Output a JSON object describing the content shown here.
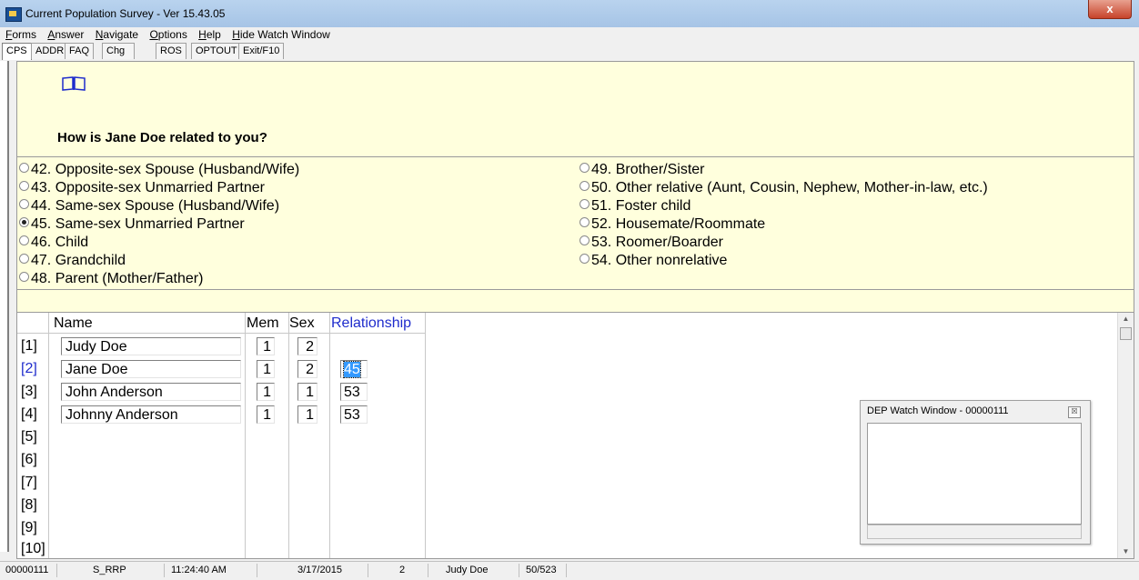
{
  "window": {
    "title": "Current Population Survey - Ver 15.43.05",
    "close_label": "x"
  },
  "menu": [
    "Forms",
    "Answer",
    "Navigate",
    "Options",
    "Help",
    "Hide Watch Window"
  ],
  "tabs": [
    "CPS",
    "ADDR",
    "FAQ",
    "Chg Resp",
    "ROS",
    "OPTOUT",
    "Exit/F10"
  ],
  "question": {
    "icon": "book-icon",
    "text": "How is Jane Doe related to you?"
  },
  "options": [
    {
      "label": "42. Opposite-sex Spouse (Husband/Wife)",
      "selected": false
    },
    {
      "label": "43. Opposite-sex Unmarried Partner",
      "selected": false
    },
    {
      "label": "44. Same-sex Spouse (Husband/Wife)",
      "selected": false
    },
    {
      "label": "45. Same-sex Unmarried Partner",
      "selected": true
    },
    {
      "label": "46. Child",
      "selected": false
    },
    {
      "label": "47. Grandchild",
      "selected": false
    },
    {
      "label": "48. Parent (Mother/Father)",
      "selected": false
    },
    {
      "label": "49. Brother/Sister",
      "selected": false
    },
    {
      "label": "50. Other relative (Aunt, Cousin, Nephew, Mother-in-law, etc.)",
      "selected": false
    },
    {
      "label": "51. Foster child",
      "selected": false
    },
    {
      "label": "52. Housemate/Roommate",
      "selected": false
    },
    {
      "label": "53. Roomer/Boarder",
      "selected": false
    },
    {
      "label": "54. Other nonrelative",
      "selected": false
    }
  ],
  "roster": {
    "headers": {
      "name": "Name",
      "mem": "Mem",
      "sex": "Sex",
      "relationship": "Relationship"
    },
    "row_labels": [
      "[1]",
      "[2]",
      "[3]",
      "[4]",
      "[5]",
      "[6]",
      "[7]",
      "[8]",
      "[9]",
      "[10]"
    ],
    "current_row": 2,
    "rows": [
      {
        "name": "Judy Doe",
        "mem": "1",
        "sex": "2",
        "relationship": ""
      },
      {
        "name": "Jane Doe",
        "mem": "1",
        "sex": "2",
        "relationship": "45"
      },
      {
        "name": "John Anderson",
        "mem": "1",
        "sex": "1",
        "relationship": "53"
      },
      {
        "name": "Johnny Anderson",
        "mem": "1",
        "sex": "1",
        "relationship": "53"
      }
    ]
  },
  "watch_window": {
    "title": "DEP Watch Window - 00000111",
    "close_label": "☒"
  },
  "status": {
    "case_id": "00000111",
    "field": "S_RRP",
    "time": "11:24:40 AM",
    "date": "3/17/2015",
    "line": "2",
    "person": "Judy Doe",
    "progress": "50/523"
  },
  "colors": {
    "question_bg": "#ffffdd",
    "accent_blue": "#1f2ccc",
    "selection": "#3399ff"
  }
}
